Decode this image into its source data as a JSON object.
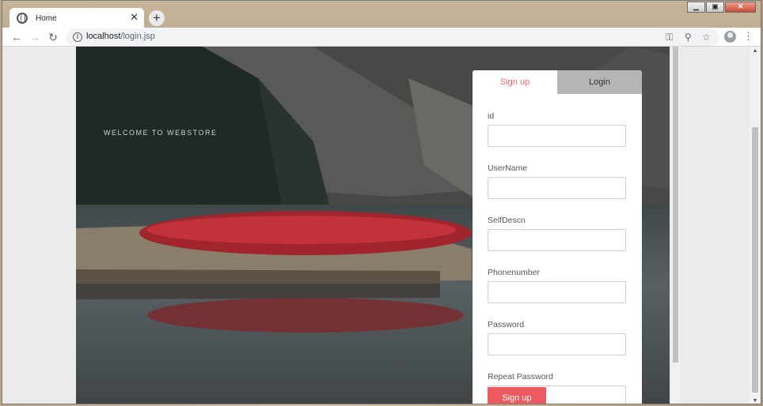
{
  "browser": {
    "tab_title": "Home",
    "tab_close": "✕",
    "new_tab": "+",
    "url_host": "localhost",
    "url_path": "/login.jsp",
    "win_minimize": "▁",
    "win_maximize": "▣",
    "win_close": "✕"
  },
  "page": {
    "welcome_text": "WELCOME TO WEBSTORE",
    "tabs": [
      "Sign up",
      "Login"
    ],
    "fields": [
      {
        "label": "id",
        "value": ""
      },
      {
        "label": "UserName",
        "value": ""
      },
      {
        "label": "SelfDescn",
        "value": ""
      },
      {
        "label": "Phonenumber",
        "value": ""
      },
      {
        "label": "Password",
        "value": ""
      },
      {
        "label": "Repeat Password",
        "value": ""
      }
    ],
    "submit_label": "Sign up",
    "accent_color": "#ee5a5f"
  }
}
